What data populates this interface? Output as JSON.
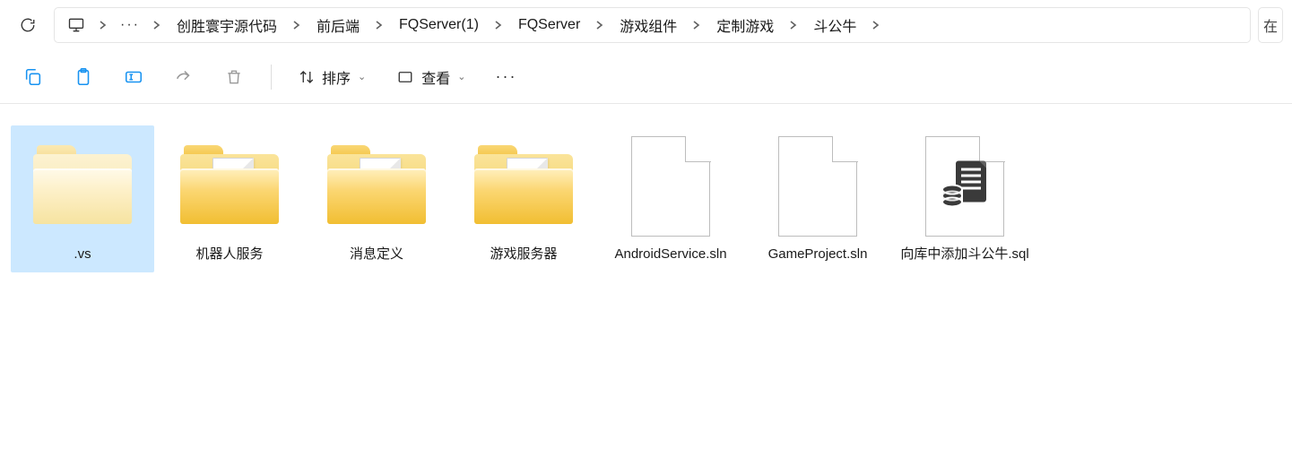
{
  "breadcrumb": {
    "segments": [
      "创胜寰宇源代码",
      "前后端",
      "FQServer(1)",
      "FQServer",
      "游戏组件",
      "定制游戏",
      "斗公牛"
    ]
  },
  "toolbar": {
    "sort_label": "排序",
    "view_label": "查看"
  },
  "right_box_text": "在",
  "items": [
    {
      "name": ".vs",
      "type": "folder-hidden",
      "selected": true
    },
    {
      "name": "机器人服务",
      "type": "folder-docs",
      "selected": false
    },
    {
      "name": "消息定义",
      "type": "folder-docs",
      "selected": false
    },
    {
      "name": "游戏服务器",
      "type": "folder-docs",
      "selected": false
    },
    {
      "name": "AndroidService.sln",
      "type": "file",
      "selected": false
    },
    {
      "name": "GameProject.sln",
      "type": "file",
      "selected": false
    },
    {
      "name": "向库中添加斗公牛.sql",
      "type": "file-sql",
      "selected": false
    }
  ]
}
